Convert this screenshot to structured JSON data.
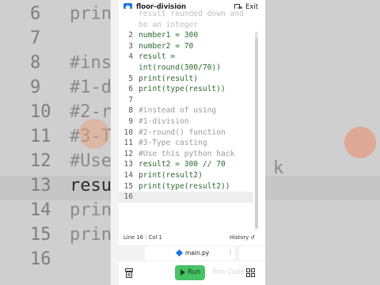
{
  "app": {
    "title": "floor-division",
    "menu_glyph": "⋮",
    "exit_label": "Exit"
  },
  "editor": {
    "lines": [
      {
        "n": "",
        "segs": [
          {
            "t": "result rounded down and",
            "k": "fade"
          }
        ]
      },
      {
        "n": "",
        "segs": [
          {
            "t": "be an integer",
            "k": "fade"
          }
        ]
      },
      {
        "n": "2",
        "segs": [
          {
            "t": "number1 = ",
            "k": "id"
          },
          {
            "t": "300",
            "k": "num"
          }
        ]
      },
      {
        "n": "3",
        "segs": [
          {
            "t": "number2 = ",
            "k": "id"
          },
          {
            "t": "70",
            "k": "num"
          }
        ]
      },
      {
        "n": "4",
        "segs": [
          {
            "t": "result =",
            "k": "id"
          }
        ]
      },
      {
        "n": "",
        "segs": [
          {
            "t": "int(round(300/70))",
            "k": "id"
          }
        ]
      },
      {
        "n": "5",
        "segs": [
          {
            "t": "print(result)",
            "k": "id"
          }
        ]
      },
      {
        "n": "6",
        "segs": [
          {
            "t": "print(type(result))",
            "k": "id"
          }
        ]
      },
      {
        "n": "7",
        "segs": []
      },
      {
        "n": "8",
        "segs": [
          {
            "t": "#instead of using",
            "k": "cm"
          }
        ]
      },
      {
        "n": "9",
        "segs": [
          {
            "t": "#1-division",
            "k": "cm"
          }
        ]
      },
      {
        "n": "10",
        "segs": [
          {
            "t": "#2-round() function",
            "k": "cm"
          }
        ]
      },
      {
        "n": "11",
        "segs": [
          {
            "t": "#3-Type casting",
            "k": "cm"
          }
        ]
      },
      {
        "n": "12",
        "segs": [
          {
            "t": "#Use this python hack",
            "k": "cm"
          }
        ]
      },
      {
        "n": "13",
        "segs": [
          {
            "t": "result2 = 300 // 70",
            "k": "id"
          }
        ]
      },
      {
        "n": "14",
        "segs": [
          {
            "t": "print(result2)",
            "k": "id"
          }
        ]
      },
      {
        "n": "15",
        "segs": [
          {
            "t": "print(type(result2))",
            "k": "id"
          }
        ]
      },
      {
        "n": "16",
        "segs": [],
        "current": true
      }
    ]
  },
  "status": {
    "cursor": "Line 16 : Col 1",
    "history_label": "History"
  },
  "tabs": {
    "active": "main.py",
    "menu_glyph": "⋮"
  },
  "toolbar": {
    "run_label": "Run",
    "ghost_text": "Run  Code"
  },
  "background": {
    "left": [
      {
        "n": "6",
        "c": "prin"
      },
      {
        "n": "7",
        "c": ""
      },
      {
        "n": "8",
        "c": "#ins"
      },
      {
        "n": "9",
        "c": "#1-d"
      },
      {
        "n": "10",
        "c": "#2-r"
      },
      {
        "n": "11",
        "c": "#3-T"
      },
      {
        "n": "12",
        "c": "#Use"
      },
      {
        "n": "13",
        "c": "resu"
      },
      {
        "n": "14",
        "c": "prin"
      },
      {
        "n": "15",
        "c": "prin"
      },
      {
        "n": "16",
        "c": ""
      }
    ],
    "right": [
      "k"
    ]
  },
  "colors": {
    "run": "#47c266",
    "accent": "#1a73e8"
  }
}
